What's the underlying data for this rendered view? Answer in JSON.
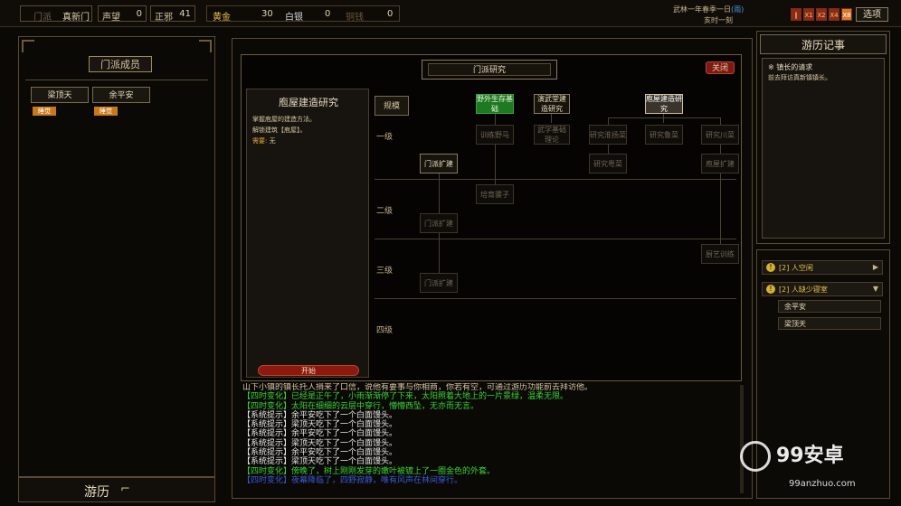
{
  "topbar": {
    "sect_label": "门派",
    "sect_name": "真新门",
    "fame_label": "声望",
    "fame_value": "0",
    "evil_label": "正邪",
    "evil_value": "41",
    "gold_label": "黄金",
    "gold_value": "30",
    "silver_label": "白银",
    "silver_value": "0",
    "copper_label": "铜钱",
    "copper_value": "0",
    "date_line1": "武林一年春季一日",
    "weather": "(雨)",
    "date_line2": "亥时一刻",
    "speeds": [
      "‖",
      "X1",
      "X2",
      "X4",
      "X8"
    ],
    "options_label": "选项"
  },
  "left_panel": {
    "title": "门派成员",
    "members": [
      {
        "name": "梁顶天",
        "status": "睡觉"
      },
      {
        "name": "余平安",
        "status": "睡觉"
      }
    ],
    "travel_label": "游历"
  },
  "research": {
    "window_title": "门派研究",
    "close_label": "关闭",
    "detail": {
      "title": "庖屋建造研究",
      "desc1": "掌握庖屋的建造方法。",
      "desc2": "解锁建筑【庖屋】。",
      "need_label": "需要:",
      "need_value": "无",
      "start_label": "开始"
    },
    "scale_label": "规模",
    "tiers": [
      "一级",
      "二级",
      "三级",
      "四级"
    ],
    "nodes": {
      "n1": "野外生存基础",
      "n2": "演武堂建造研究",
      "n3": "庖屋建造研究",
      "n4": "训练野马",
      "n5": "武学基础理论",
      "n6": "研究淮扬菜",
      "n7": "研究鲁菜",
      "n8": "研究川菜",
      "n9": "门派扩建",
      "n10": "研究粤菜",
      "n11": "庖屋扩建",
      "n12": "培育骡子",
      "n13": "门派扩建",
      "n14": "厨艺训练",
      "n15": "门派扩建"
    }
  },
  "right_panel": {
    "title": "游历记事",
    "entry_title": "※ 镇长的请求",
    "entry_text": "前去拜访真新镇镇长。",
    "alerts": [
      {
        "text": "[2] 人空闲",
        "arrow": "▶"
      },
      {
        "text": "[2] 人缺少寝室",
        "arrow": "▼"
      }
    ],
    "sub_items": [
      "余平安",
      "梁顶天"
    ]
  },
  "log": [
    {
      "text": "山下小镇的镇长托人捎来了口信，说他有要事与你相商，你若有空，可通过游历功能前去拜访他。",
      "color": "#d6c6a3"
    },
    {
      "text": "【四时变化】已经是正午了，小雨渐渐停了下来，太阳照着大地上的一片景绿，温柔无限。",
      "color": "#38d438"
    },
    {
      "text": "【四时变化】太阳在细细的云层中穿行，懵懵西坠，无亦而无言。",
      "color": "#38d438"
    },
    {
      "text": "【系统提示】余平安吃下了一个白面馒头。",
      "color": "#e8e8e8"
    },
    {
      "text": "【系统提示】梁顶天吃下了一个白面馒头。",
      "color": "#e8e8e8"
    },
    {
      "text": "【系统提示】余平安吃下了一个白面馒头。",
      "color": "#e8e8e8"
    },
    {
      "text": "【系统提示】梁顶天吃下了一个白面馒头。",
      "color": "#e8e8e8"
    },
    {
      "text": "【系统提示】余平安吃下了一个白面馒头。",
      "color": "#e8e8e8"
    },
    {
      "text": "【系统提示】梁顶天吃下了一个白面馒头。",
      "color": "#e8e8e8"
    },
    {
      "text": "【四时变化】傍晚了，树上刚刚发芽的嫩叶被镀上了一圈金色的外套。",
      "color": "#38d438"
    },
    {
      "text": "【四时变化】夜幕降临了，四野寂静，唯有风声在林间穿行。",
      "color": "#3a5ad8"
    }
  ],
  "watermark": {
    "brand": "99安卓",
    "site": "99anzhuo.com"
  }
}
